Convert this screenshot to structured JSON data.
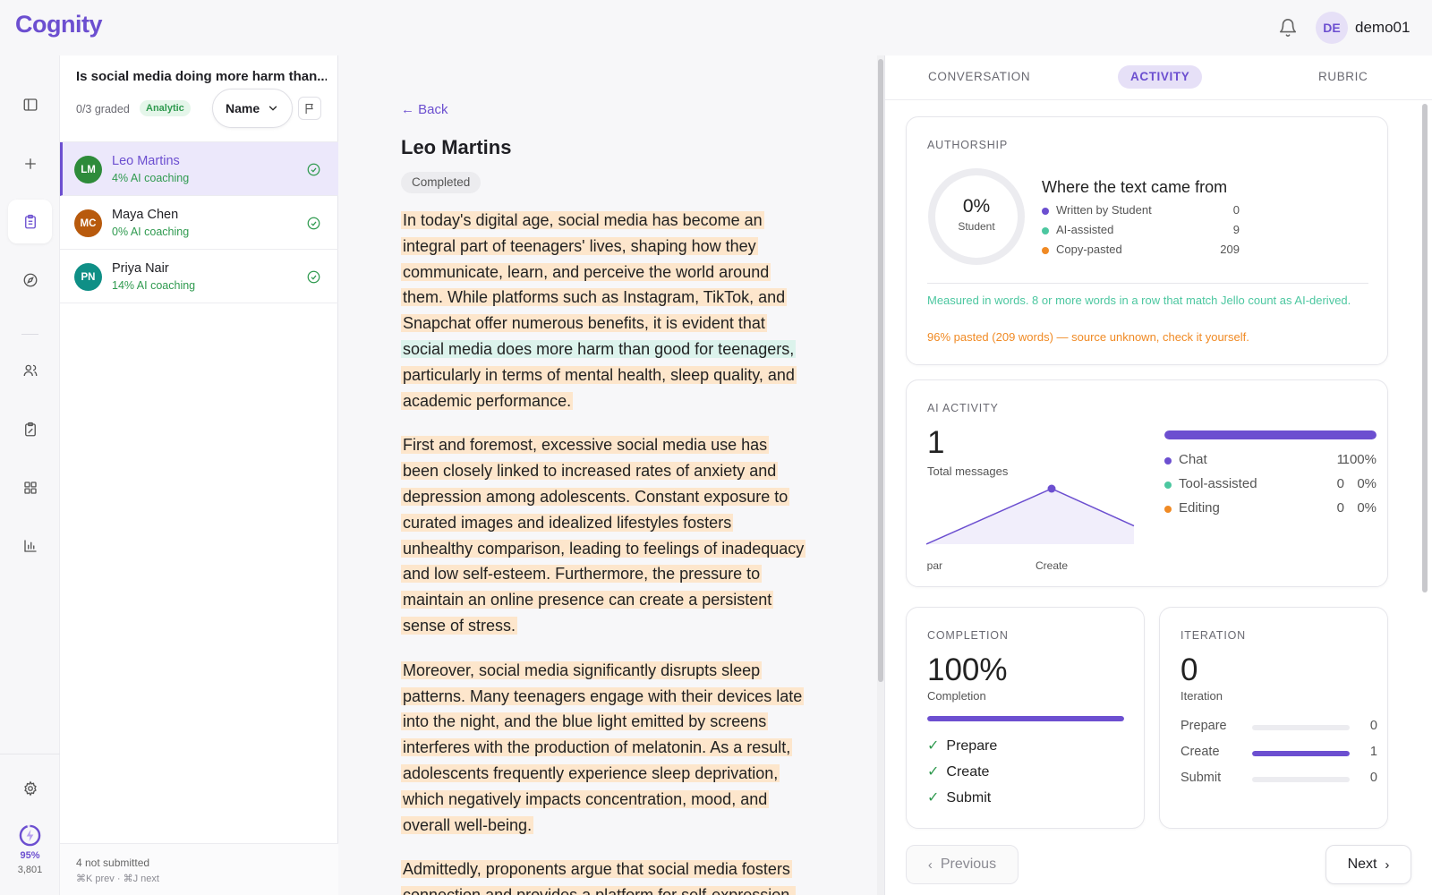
{
  "app": {
    "logo": "Cognity"
  },
  "user": {
    "initials": "DE",
    "name": "demo01"
  },
  "rail": {
    "usage_pct": "95%",
    "usage_count": "3,801"
  },
  "assignment": {
    "title": "Is social media doing more harm than...",
    "graded": "0/3 graded",
    "badge": "Analytic",
    "sort_label": "Name"
  },
  "students": [
    {
      "initials": "LM",
      "name": "Leo Martins",
      "sub": "4% AI coaching",
      "color": "#2e8b3a"
    },
    {
      "initials": "MC",
      "name": "Maya Chen",
      "sub": "0% AI coaching",
      "color": "#b85a0d"
    },
    {
      "initials": "PN",
      "name": "Priya Nair",
      "sub": "14% AI coaching",
      "color": "#0f8f86"
    }
  ],
  "list_footer": {
    "not_submitted": "4 not submitted",
    "shortcuts": "⌘K prev · ⌘J next"
  },
  "document": {
    "back": "← Back",
    "student": "Leo Martins",
    "status": "Completed",
    "p1a": "In today's digital age, social media has become an integral part of teenagers' lives, shaping how they communicate, learn, and perceive the world around them. While platforms such as Instagram, TikTok, and Snapchat offer numerous benefits, it is evident that",
    "p1b": "social media does more harm than good for teenagers,",
    "p1c": "particularly in terms of mental health, sleep quality, and academic performance.",
    "p2": "First and foremost, excessive social media use has been closely linked to increased rates of anxiety and depression among adolescents. Constant exposure to curated images and idealized lifestyles fosters unhealthy comparison, leading to feelings of inadequacy and low self-esteem. Furthermore, the pressure to maintain an online presence can create a persistent sense of stress.",
    "p3": "Moreover, social media significantly disrupts sleep patterns. Many teenagers engage with their devices late into the night, and the blue light emitted by screens interferes with the production of melatonin. As a result, adolescents frequently experience sleep deprivation, which negatively impacts concentration, mood, and overall well-being.",
    "p4": "Admittedly, proponents argue that social media fosters connection and provides a platform for self-expression."
  },
  "tabs": [
    "CONVERSATION",
    "ACTIVITY",
    "RUBRIC"
  ],
  "colors": {
    "accent": "#6c4fd0",
    "written": "#6c4fd0",
    "ai": "#4cc7a0",
    "paste": "#f08a24"
  },
  "authorship": {
    "label": "AUTHORSHIP",
    "ring_pct": "0%",
    "ring_sub": "Student",
    "student_fraction": 0,
    "title": "Where the text came from",
    "legend": [
      {
        "label": "Written by Student",
        "value": "0"
      },
      {
        "label": "AI-assisted",
        "value": "9"
      },
      {
        "label": "Copy-pasted",
        "value": "209"
      }
    ],
    "note": "Measured in words. 8 or more words in a row that match Jello count as AI-derived.",
    "warning": "96% pasted (209 words) — source unknown, check it yourself."
  },
  "ai_activity": {
    "label": "AI ACTIVITY",
    "total": "1",
    "total_label": "Total messages",
    "bar_fraction": 1.0,
    "legend": [
      {
        "label": "Chat",
        "count": "1",
        "pct": "100%"
      },
      {
        "label": "Tool-assisted",
        "count": "0",
        "pct": "0%"
      },
      {
        "label": "Editing",
        "count": "0",
        "pct": "0%"
      }
    ],
    "spark_labels": [
      "epar",
      "Create"
    ],
    "spark_values": [
      0,
      1,
      0.33
    ]
  },
  "completion": {
    "label": "COMPLETION",
    "value": "100%",
    "sub": "Completion",
    "fraction": 1.0,
    "steps": [
      "Prepare",
      "Create",
      "Submit"
    ]
  },
  "iteration": {
    "label": "ITERATION",
    "value": "0",
    "sub": "Iteration",
    "rows": [
      {
        "label": "Prepare",
        "value": "0",
        "fraction": 0
      },
      {
        "label": "Create",
        "value": "1",
        "fraction": 1
      },
      {
        "label": "Submit",
        "value": "0",
        "fraction": 0
      }
    ]
  },
  "nav": {
    "previous": "Previous",
    "next": "Next"
  }
}
